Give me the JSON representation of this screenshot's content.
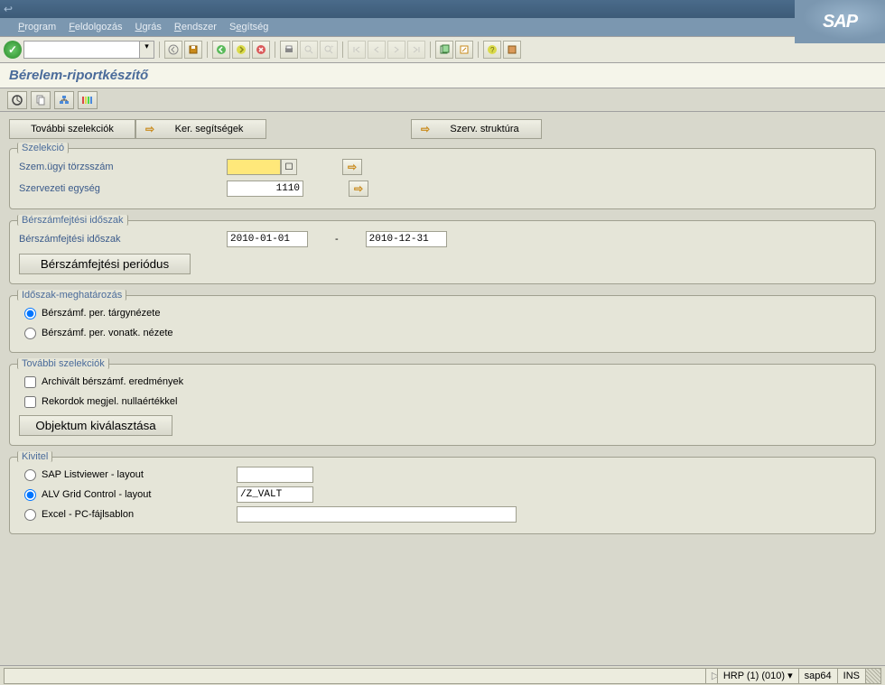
{
  "menubar": {
    "items": [
      "Program",
      "Feldolgozás",
      "Ugrás",
      "Rendszer",
      "Segítség"
    ],
    "keys": [
      "P",
      "F",
      "U",
      "R",
      "S"
    ]
  },
  "page_title": "Bérelem-riportkészítő",
  "button_row": {
    "tovabbi": "További szelekciók",
    "ker": "Ker. segítségek",
    "szerv": "Szerv. struktúra"
  },
  "szelekcio": {
    "legend": "Szelekció",
    "torzs_label": "Szem.ügyi törzsszám",
    "torzs_value": "",
    "szerv_label": "Szervezeti egység",
    "szerv_value": "1110"
  },
  "berszam": {
    "legend": "Bérszámfejtési időszak",
    "idoszak_label": "Bérszámfejtési időszak",
    "from": "2010-01-01",
    "to": "2010-12-31",
    "periodus_btn": "Bérszámfejtési periódus"
  },
  "idoszak_meg": {
    "legend": "Időszak-meghatározás",
    "r1": "Bérszámf. per. tárgynézete",
    "r2": "Bérszámf. per. vonatk. nézete"
  },
  "tovabbi_sz": {
    "legend": "További szelekciók",
    "c1": "Archivált bérszámf. eredmények",
    "c2": "Rekordok megjel. nullaértékkel",
    "obj_btn": "Objektum kiválasztása"
  },
  "kivitel": {
    "legend": "Kivitel",
    "r1": "SAP Listviewer - layout",
    "r2": "ALV Grid Control - layout",
    "r3": "Excel - PC-fájlsablon",
    "alv_value": "/Z_VALT"
  },
  "status": {
    "system": "HRP (1) (010)",
    "server": "sap64",
    "mode": "INS"
  },
  "sap_logo": "SAP",
  "titlebar_btns": [
    "_",
    "□",
    "×"
  ]
}
